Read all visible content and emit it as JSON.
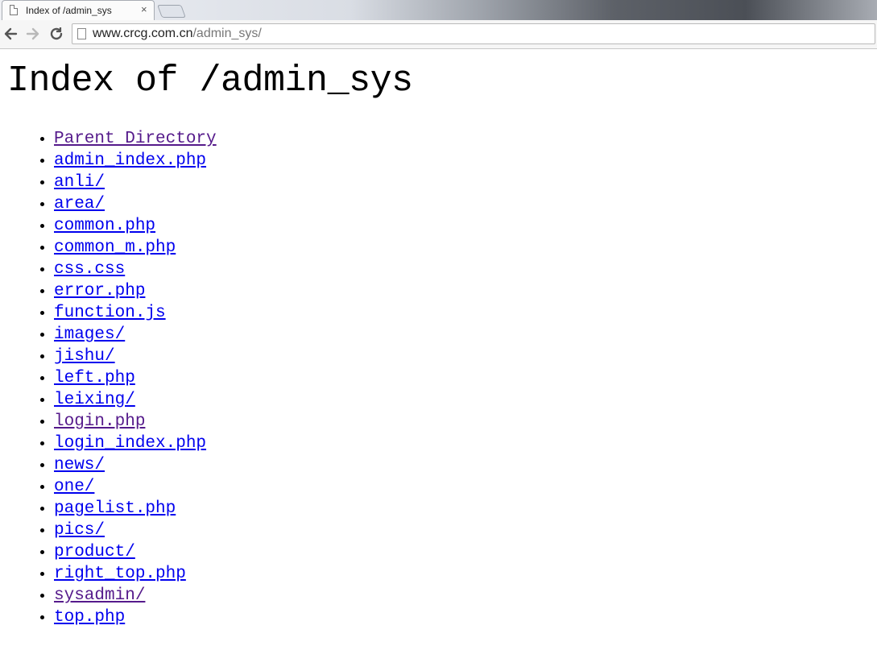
{
  "browser": {
    "tab_title": "Index of /admin_sys",
    "tab_close": "×",
    "url_host": "www.crcg.com.cn",
    "url_path": "/admin_sys/",
    "icons": {
      "back": "back-arrow-icon",
      "forward": "forward-arrow-icon",
      "reload": "reload-icon",
      "page": "page-icon"
    }
  },
  "page": {
    "heading": "Index of /admin_sys",
    "entries": [
      {
        "label": "Parent Directory",
        "visited": true
      },
      {
        "label": "admin_index.php",
        "visited": false
      },
      {
        "label": "anli/",
        "visited": false
      },
      {
        "label": "area/",
        "visited": false
      },
      {
        "label": "common.php",
        "visited": false
      },
      {
        "label": "common_m.php",
        "visited": false
      },
      {
        "label": "css.css",
        "visited": false
      },
      {
        "label": "error.php",
        "visited": false
      },
      {
        "label": "function.js",
        "visited": false
      },
      {
        "label": "images/",
        "visited": false
      },
      {
        "label": "jishu/",
        "visited": false
      },
      {
        "label": "left.php",
        "visited": false
      },
      {
        "label": "leixing/",
        "visited": false
      },
      {
        "label": "login.php",
        "visited": true
      },
      {
        "label": "login_index.php",
        "visited": false
      },
      {
        "label": "news/",
        "visited": false
      },
      {
        "label": "one/",
        "visited": false
      },
      {
        "label": "pagelist.php",
        "visited": false
      },
      {
        "label": "pics/",
        "visited": false
      },
      {
        "label": "product/",
        "visited": false
      },
      {
        "label": "right_top.php",
        "visited": false
      },
      {
        "label": "sysadmin/",
        "visited": true
      },
      {
        "label": "top.php",
        "visited": false
      }
    ]
  },
  "colors": {
    "link": "#0000ee",
    "visited_link": "#551a8b"
  }
}
